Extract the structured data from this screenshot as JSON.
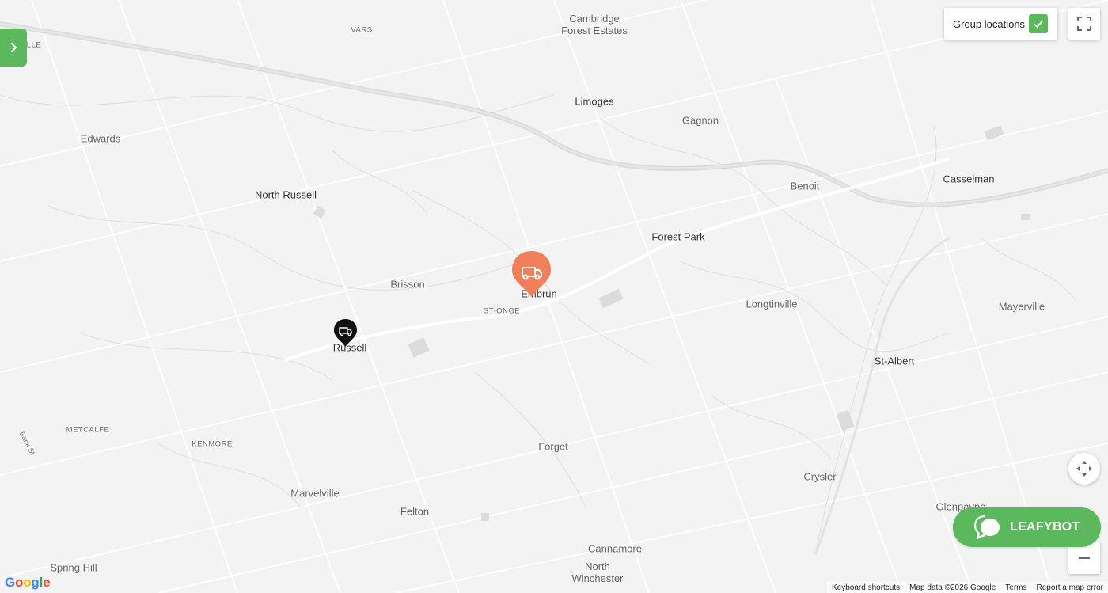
{
  "map": {
    "places": [
      {
        "name": "Cambridge\nForest Estates",
        "cls": ""
      },
      {
        "name": "VARS",
        "cls": "small"
      },
      {
        "name": "LLE",
        "cls": "small"
      },
      {
        "name": "Limoges",
        "cls": "dark"
      },
      {
        "name": "Gagnon",
        "cls": ""
      },
      {
        "name": "Edwards",
        "cls": ""
      },
      {
        "name": "North Russell",
        "cls": "dark"
      },
      {
        "name": "Benoit",
        "cls": ""
      },
      {
        "name": "Casselman",
        "cls": "dark"
      },
      {
        "name": "Forest Park",
        "cls": "dark"
      },
      {
        "name": "Brisson",
        "cls": ""
      },
      {
        "name": "Embrun",
        "cls": "dark"
      },
      {
        "name": "ST-ONGE",
        "cls": "small"
      },
      {
        "name": "Longtinville",
        "cls": ""
      },
      {
        "name": "Mayerville",
        "cls": ""
      },
      {
        "name": "Russell",
        "cls": "dark"
      },
      {
        "name": "St-Albert",
        "cls": "dark"
      },
      {
        "name": "METCALFE",
        "cls": "small"
      },
      {
        "name": "KENMORE",
        "cls": "small"
      },
      {
        "name": "Forget",
        "cls": ""
      },
      {
        "name": "Crysler",
        "cls": ""
      },
      {
        "name": "Marvelville",
        "cls": ""
      },
      {
        "name": "Felton",
        "cls": ""
      },
      {
        "name": "Glenpayne",
        "cls": ""
      },
      {
        "name": "Cannamore",
        "cls": ""
      },
      {
        "name": "North\nWinchester",
        "cls": ""
      },
      {
        "name": "Spring Hill",
        "cls": ""
      },
      {
        "name": "Bank St",
        "cls": "road"
      }
    ],
    "markers": [
      {
        "name": "delivery-van-marker-embrun",
        "color": "#f07f5a",
        "icon": "van-icon"
      },
      {
        "name": "delivery-van-marker-russell",
        "color": "#111111",
        "icon": "van-icon"
      }
    ]
  },
  "controls": {
    "group_locations_label": "Group locations",
    "group_locations_checked": true,
    "sidebar_toggle_icon": "chevron-right-icon",
    "fullscreen_icon": "fullscreen-icon",
    "recenter_icon": "move-arrows-icon",
    "zoom_out_icon": "minus-icon"
  },
  "leafybot": {
    "label": "LEAFYBOT",
    "color": "#5cb85c"
  },
  "footer": {
    "keyboard_shortcuts": "Keyboard shortcuts",
    "map_data": "Map data ©2026 Google",
    "terms": "Terms",
    "report": "Report a map error"
  },
  "branding": {
    "google_logo": "Google"
  }
}
